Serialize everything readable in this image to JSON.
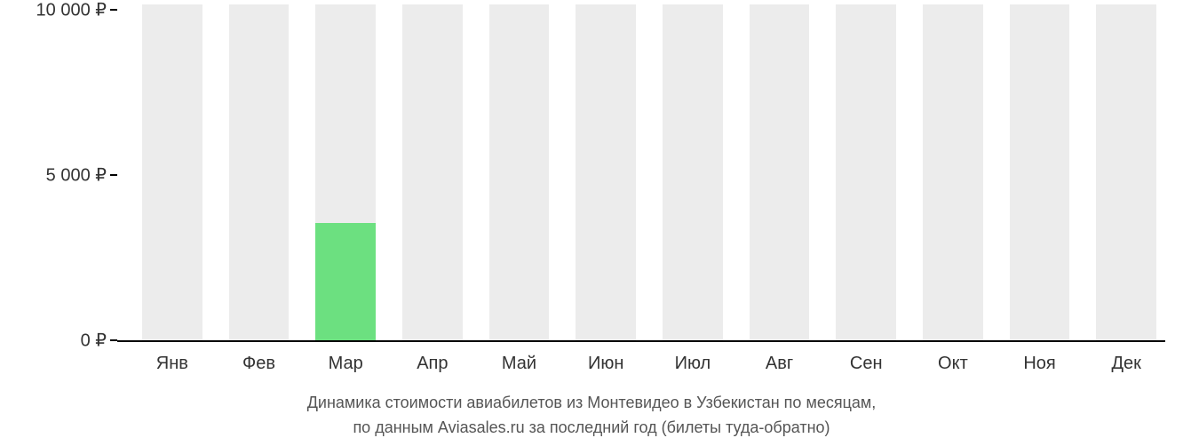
{
  "chart_data": {
    "type": "bar",
    "categories": [
      "Янв",
      "Фев",
      "Мар",
      "Апр",
      "Май",
      "Июн",
      "Июл",
      "Авг",
      "Сен",
      "Окт",
      "Ноя",
      "Дек"
    ],
    "values": [
      null,
      null,
      3700,
      null,
      null,
      null,
      null,
      null,
      null,
      null,
      null,
      null
    ],
    "title": "",
    "xlabel": "",
    "ylabel": "",
    "ylim": [
      0,
      10500
    ],
    "yticks": [
      0,
      5000,
      10000
    ],
    "ytick_labels": [
      "0 ₽",
      "5 000 ₽",
      "10 000 ₽"
    ],
    "caption_line1": "Динамика стоимости авиабилетов из Монтевидео в Узбекистан по месяцам,",
    "caption_line2": "по данным Aviasales.ru за последний год (билеты туда-обратно)",
    "colors": {
      "bar_placeholder": "#ececec",
      "bar_value": "#6ce080"
    }
  }
}
